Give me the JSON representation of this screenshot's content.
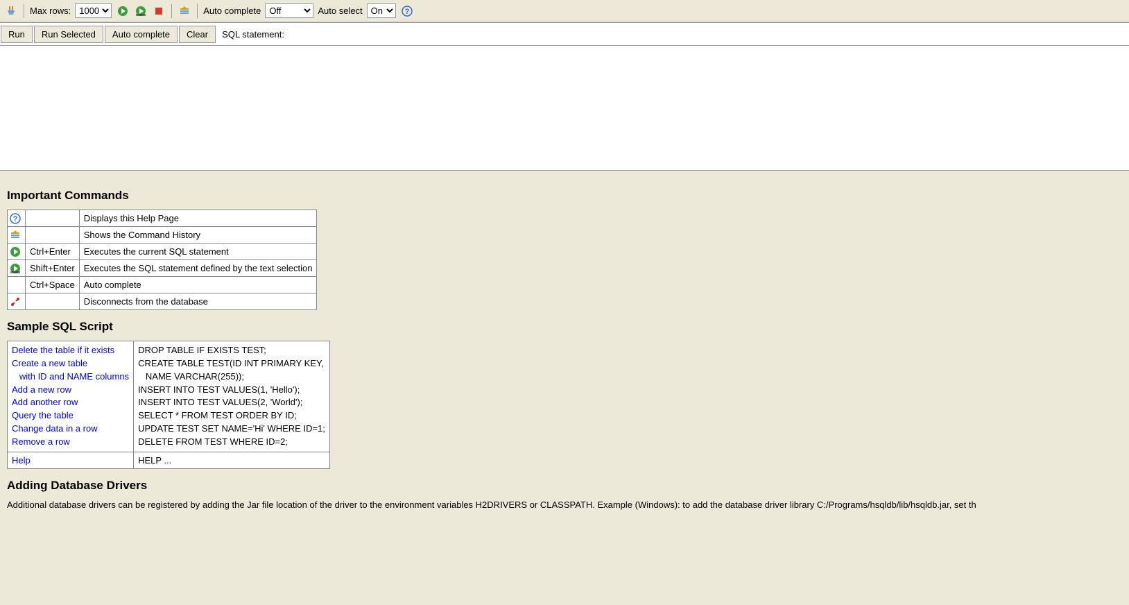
{
  "toolbar": {
    "max_rows_label": "Max rows:",
    "max_rows_value": "1000",
    "auto_complete_label": "Auto complete",
    "auto_complete_value": "Off",
    "auto_select_label": "Auto select",
    "auto_select_value": "On"
  },
  "query_bar": {
    "run": "Run",
    "run_selected": "Run Selected",
    "auto_complete": "Auto complete",
    "clear": "Clear",
    "sql_label": "SQL statement:"
  },
  "sections": {
    "important_commands": "Important Commands",
    "sample_sql": "Sample SQL Script",
    "adding_drivers": "Adding Database Drivers"
  },
  "commands": [
    {
      "icon": "help",
      "key": "",
      "desc": "Displays this Help Page"
    },
    {
      "icon": "history",
      "key": "",
      "desc": "Shows the Command History"
    },
    {
      "icon": "run",
      "key": "Ctrl+Enter",
      "desc": "Executes the current SQL statement"
    },
    {
      "icon": "run-selected",
      "key": "Shift+Enter",
      "desc": "Executes the SQL statement defined by the text selection"
    },
    {
      "icon": "",
      "key": "Ctrl+Space",
      "desc": "Auto complete"
    },
    {
      "icon": "disconnect",
      "key": "",
      "desc": "Disconnects from the database"
    }
  ],
  "sample": {
    "desc_block": "Delete the table if it exists\nCreate a new table\n   with ID and NAME columns\nAdd a new row\nAdd another row\nQuery the table\nChange data in a row\nRemove a row",
    "sql_block": "DROP TABLE IF EXISTS TEST;\nCREATE TABLE TEST(ID INT PRIMARY KEY,\n   NAME VARCHAR(255));\nINSERT INTO TEST VALUES(1, 'Hello');\nINSERT INTO TEST VALUES(2, 'World');\nSELECT * FROM TEST ORDER BY ID;\nUPDATE TEST SET NAME='Hi' WHERE ID=1;\nDELETE FROM TEST WHERE ID=2;",
    "help_label": "Help",
    "help_sql": "HELP ..."
  },
  "drivers_text": "Additional database drivers can be registered by adding the Jar file location of the driver to the environment variables H2DRIVERS or CLASSPATH. Example (Windows): to add the database driver library C:/Programs/hsqldb/lib/hsqldb.jar, set th"
}
